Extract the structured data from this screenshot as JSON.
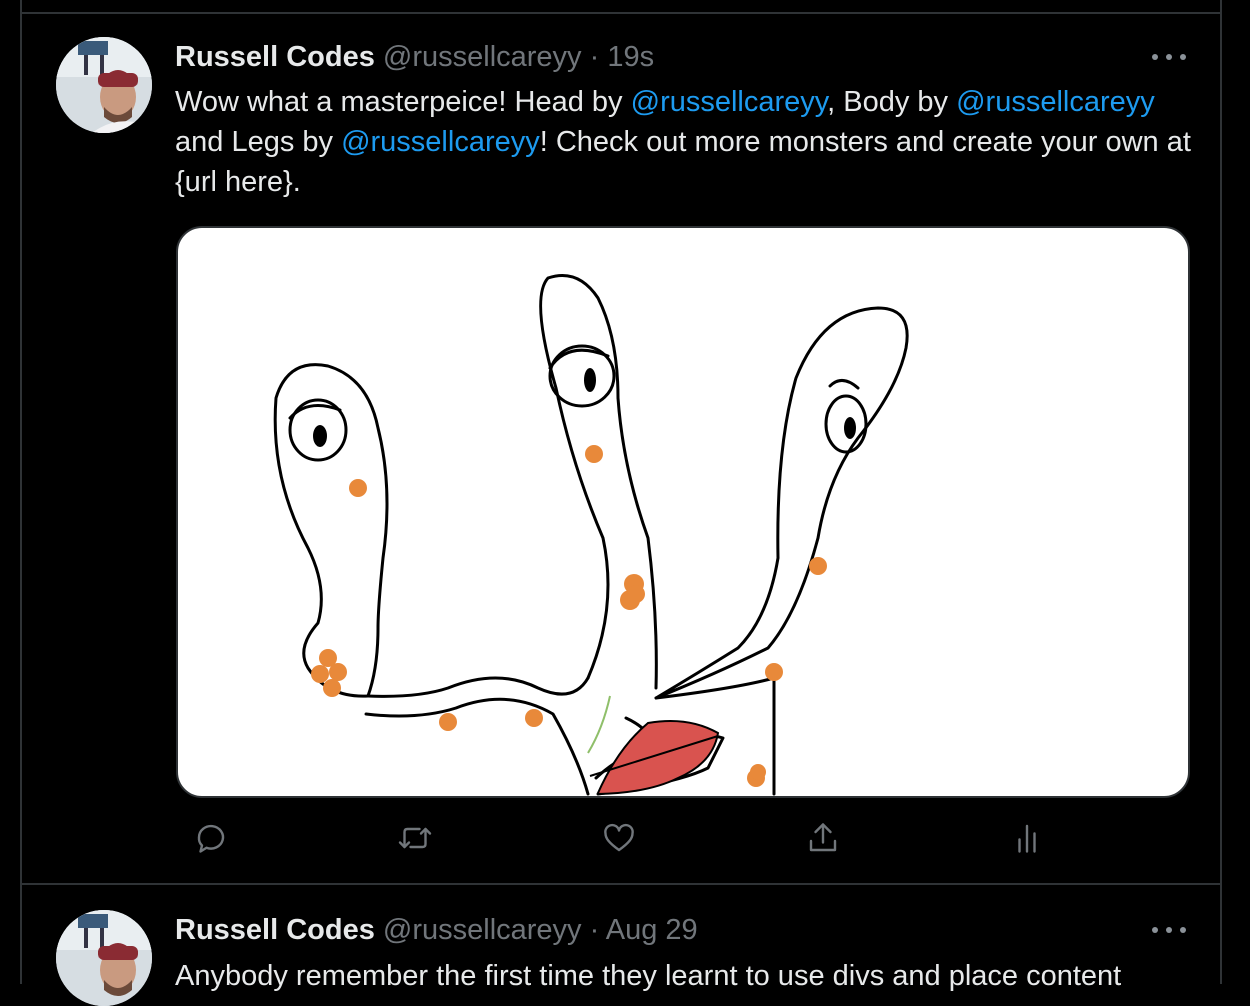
{
  "tweets": [
    {
      "author_name": "Russell Codes",
      "handle": "@russellcareyy",
      "separator": "·",
      "time": "19s",
      "text": {
        "part1": "Wow what a masterpeice! Head by ",
        "mention1": "@russellcareyy",
        "part2": ", Body by ",
        "mention2": "@russellcareyy",
        "part3": " and Legs by ",
        "mention3": "@russellcareyy",
        "part4": "! Check out more monsters and create your own at {url here}."
      },
      "media": "monster-drawing",
      "actions": [
        "reply-icon",
        "retweet-icon",
        "like-icon",
        "share-icon",
        "analytics-icon"
      ]
    },
    {
      "author_name": "Russell Codes",
      "handle": "@russellcareyy",
      "separator": "·",
      "time": "Aug 29",
      "text": "Anybody remember the first time they learnt to use divs and place content"
    }
  ],
  "colors": {
    "background": "#000000",
    "border": "#2f3336",
    "text": "#e7e9ea",
    "muted": "#71767b",
    "accent": "#1d9bf0",
    "drawing_dots": "#e8893a",
    "drawing_lips": "#d9534f"
  }
}
